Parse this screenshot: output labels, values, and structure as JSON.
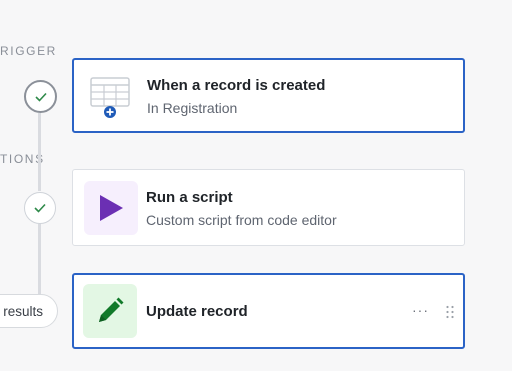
{
  "sections": {
    "trigger_label": "RIGGER",
    "actions_label": "TIONS"
  },
  "trigger": {
    "title": "When a record is created",
    "subtitle": "In Registration",
    "icon": "table-add-icon"
  },
  "actions": [
    {
      "title": "Run a script",
      "subtitle": "Custom script from code editor",
      "icon": "play-icon",
      "icon_color": "#6b2fb3",
      "tile_color": "#f6effd"
    },
    {
      "title": "Update record",
      "icon": "pencil-icon",
      "icon_color": "#127a2a",
      "tile_color": "#e3f7e4",
      "more_label": "···"
    }
  ],
  "results_pill": "results",
  "colors": {
    "accent": "#2b63c6",
    "check": "#2f8a4a"
  }
}
